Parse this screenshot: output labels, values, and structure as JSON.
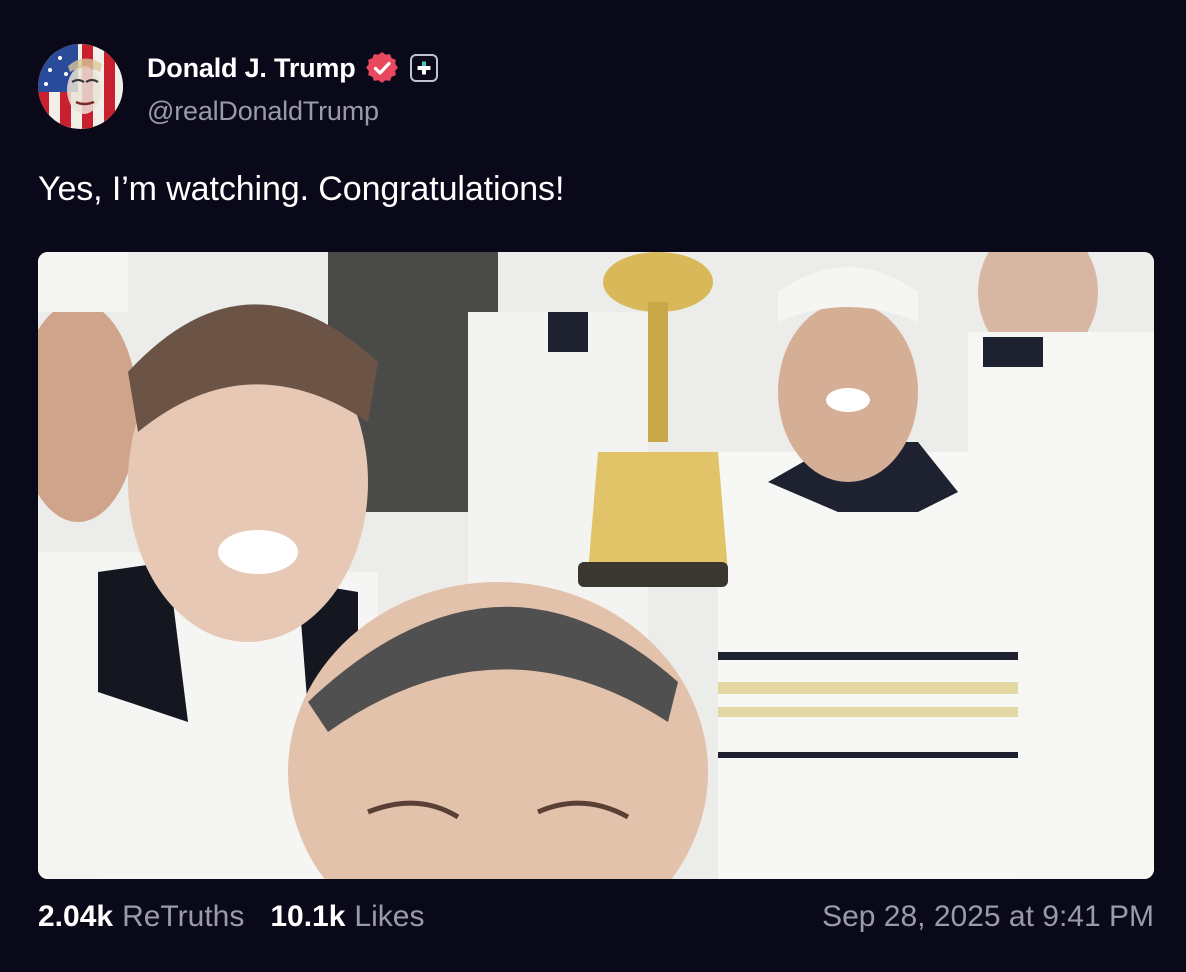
{
  "author": {
    "display_name": "Donald J. Trump",
    "handle": "@realDonaldTrump",
    "avatar_icon": "flag-portrait-avatar",
    "verified_icon": "verified-badge-icon",
    "verified_color": "#e8495f",
    "extra_badge_icon": "plus-badge-icon"
  },
  "post": {
    "text": "Yes, I’m watching. Congratulations!",
    "media_type": "photo"
  },
  "stats": {
    "retruths_count": "2.04k",
    "retruths_label": "ReTruths",
    "likes_count": "10.1k",
    "likes_label": "Likes"
  },
  "timestamp": "Sep 28, 2025 at 9:41 PM",
  "colors": {
    "background": "#0a0919",
    "primary_text": "#ffffff",
    "secondary_text": "#9a9aa8"
  }
}
